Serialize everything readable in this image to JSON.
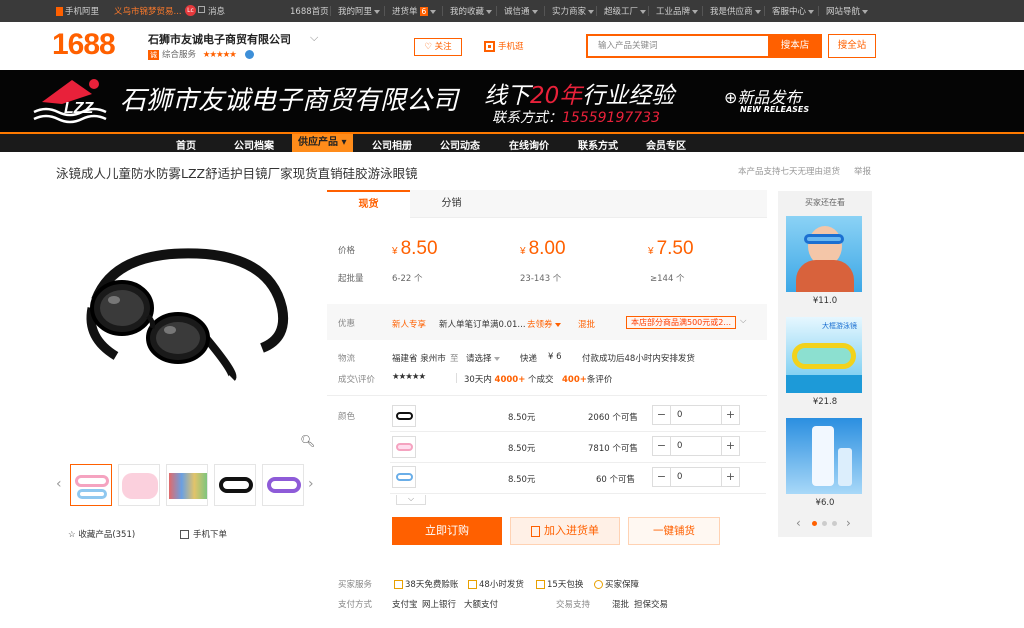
{
  "topbar": {
    "items": [
      "手机阿里",
      "义乌市锦梦贸易...",
      "消息",
      "1688首页",
      "我的阿里",
      "进货单",
      "我的收藏",
      "诚信通",
      "实力商家",
      "超级工厂",
      "工业品牌",
      "我是供应商",
      "客服中心",
      "网站导航"
    ],
    "cart_count": "6",
    "badge": "Lc"
  },
  "header": {
    "logo": "1688",
    "shop_name": "石狮市友诚电子商贸有限公司",
    "shop_sub": "综合服务",
    "stars": "★★★★★",
    "follow_label": "关注",
    "mobile_shop_label": "手机逛",
    "search_placeholder": "输入产品关键词",
    "search_shop_label": "搜本店",
    "search_all_label": "搜全站"
  },
  "banner": {
    "brand": "LZZ",
    "company": "石狮市友诚电子商贸有限公司",
    "slogan_pre": "线下",
    "slogan_num": "20年",
    "slogan_post": "行业经验",
    "contact_label": "联系方式：",
    "contact_phone": "15559197733",
    "new_release": "新品发布",
    "new_release_en": "NEW RELEASES"
  },
  "nav": [
    "首页",
    "公司档案",
    "供应产品 ▾",
    "公司相册",
    "公司动态",
    "在线询价",
    "联系方式",
    "会员专区"
  ],
  "product": {
    "title": "泳镜成人儿童防水防雾LZZ舒适护目镜厂家现货直销硅胶游泳眼镜",
    "right_note": "本产品支持七天无理由退货",
    "report": "举报",
    "collect": "收藏产品(351)",
    "mobile_order": "手机下单"
  },
  "tabs": [
    "现货",
    "分销"
  ],
  "price": {
    "label": "价格",
    "qty_label": "起批量",
    "tiers": [
      {
        "price": "8.50",
        "qty": "6-22 个"
      },
      {
        "price": "8.00",
        "qty": "23-143 个"
      },
      {
        "price": "7.50",
        "qty": "≥144 个"
      }
    ],
    "currency": "¥"
  },
  "promo": {
    "label": "优惠",
    "new_user": "新人专享",
    "new_user_detail": "新人单笔订单满0.01...",
    "claim": "去领券",
    "mix": "混批",
    "coupon": "本店部分商品满500元或2..."
  },
  "logistics": {
    "label": "物流",
    "from": "福建省 泉州市",
    "to_label": "至",
    "to": "请选择",
    "express": "快递",
    "fee": "¥ 6",
    "ship_note": "付款成功后48小时内安排发货",
    "deal_label": "成交\\评价",
    "stars": "★★★★★",
    "deals_pre": "30天内",
    "deals_num": "4000+",
    "deals_post": "个成交",
    "reviews_num": "400+",
    "reviews_post": "条评价"
  },
  "sku": {
    "label": "颜色",
    "rows": [
      {
        "price": "8.50元",
        "stock": "2060 个可售",
        "qty": "0"
      },
      {
        "price": "8.50元",
        "stock": "7810 个可售",
        "qty": "0"
      },
      {
        "price": "8.50元",
        "stock": "60 个可售",
        "qty": "0"
      }
    ]
  },
  "actions": {
    "order": "立即订购",
    "cart": "加入进货单",
    "onekey": "一键铺货"
  },
  "services": {
    "label": "买家服务",
    "items": [
      "38天免费赊账",
      "48小时发货",
      "15天包换",
      "买家保障"
    ],
    "pay_label": "支付方式",
    "pay_items": [
      "支付宝",
      "网上银行",
      "大额支付"
    ],
    "trade_label": "交易支持",
    "trade_items": [
      "混批",
      "担保交易"
    ]
  },
  "right": {
    "title": "买家还在看",
    "prices": [
      "¥11.0",
      "¥21.8",
      "¥6.0"
    ],
    "img2_label": "大框游泳镜"
  },
  "colors": {
    "accent": "#ff6000",
    "banner_bg": "#050505",
    "topbar_bg": "#3a3a3a"
  }
}
